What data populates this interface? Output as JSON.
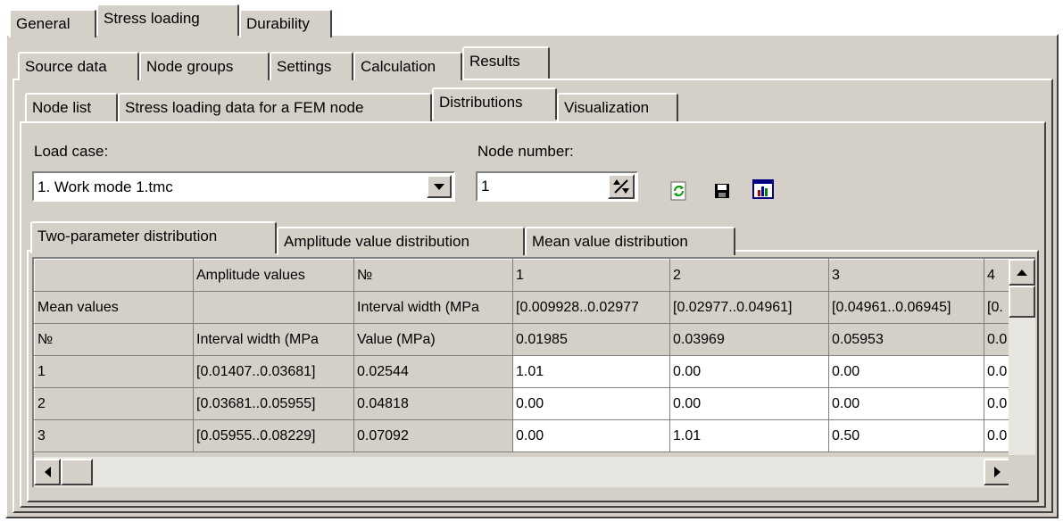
{
  "top_tabs": [
    "General",
    "Stress loading",
    "Durability"
  ],
  "sub_tabs": [
    "Source data",
    "Node groups",
    "Settings",
    "Calculation",
    "Results"
  ],
  "results_tabs": [
    "Node list",
    "Stress loading data for a FEM node",
    "Distributions",
    "Visualization"
  ],
  "form": {
    "load_case_label": "Load case:",
    "load_case_value": "1. Work mode 1.tmc",
    "node_number_label": "Node number:",
    "node_number_value": "1"
  },
  "toolbar_icons": [
    "refresh-icon",
    "save-icon",
    "chart-icon"
  ],
  "dist_tabs": [
    "Two-parameter distribution",
    "Amplitude value distribution",
    "Mean value distribution"
  ],
  "grid": {
    "rows": [
      [
        "",
        "Amplitude values",
        "№",
        "1",
        "2",
        "3",
        "4"
      ],
      [
        "Mean values",
        "",
        "Interval width (MPa",
        "[0.009928..0.02977",
        "[0.02977..0.04961]",
        "[0.04961..0.06945]",
        "[0."
      ],
      [
        "№",
        "Interval width (MPa",
        "Value (MPa)",
        "0.01985",
        "0.03969",
        "0.05953",
        "0.0"
      ],
      [
        "1",
        "[0.01407..0.03681]",
        "0.02544",
        "1.01",
        "0.00",
        "0.00",
        "0.0"
      ],
      [
        "2",
        "[0.03681..0.05955]",
        "0.04818",
        "0.00",
        "0.00",
        "0.00",
        "0.0"
      ],
      [
        "3",
        "[0.05955..0.08229]",
        "0.07092",
        "0.00",
        "1.01",
        "0.50",
        "0.0"
      ]
    ]
  }
}
